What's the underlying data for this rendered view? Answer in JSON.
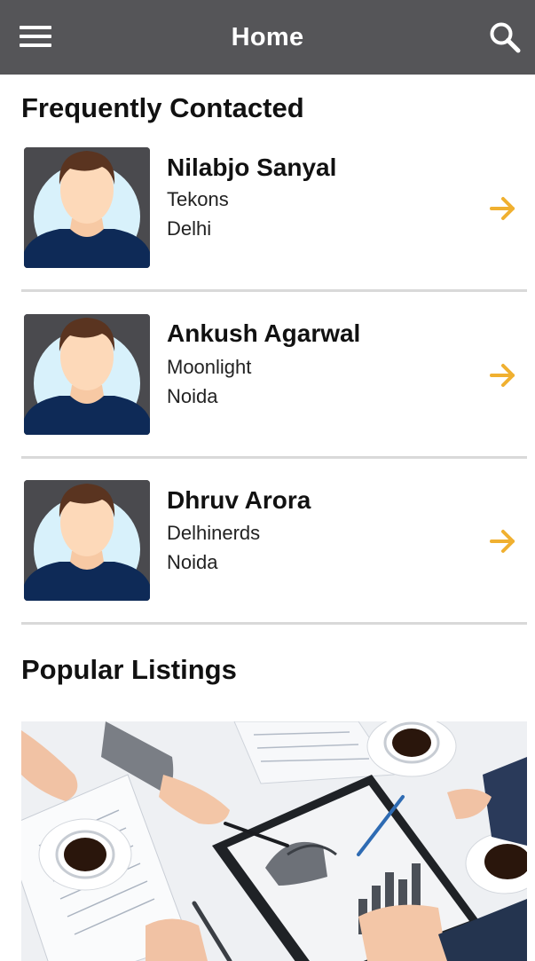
{
  "header": {
    "title": "Home",
    "menu_icon": "hamburger-menu-icon",
    "search_icon": "search-icon",
    "background": "#555558"
  },
  "frequently_contacted": {
    "title": "Frequently Contacted",
    "contacts": [
      {
        "name": "Nilabjo Sanyal",
        "company": "Tekons",
        "city": "Delhi"
      },
      {
        "name": "Ankush Agarwal",
        "company": "Moonlight",
        "city": "Noida"
      },
      {
        "name": "Dhruv Arora",
        "company": "Delhinerds",
        "city": "Noida"
      }
    ],
    "arrow_icon": "arrow-right-icon",
    "accent": "#f0b030"
  },
  "popular_listings": {
    "title": "Popular Listings"
  }
}
